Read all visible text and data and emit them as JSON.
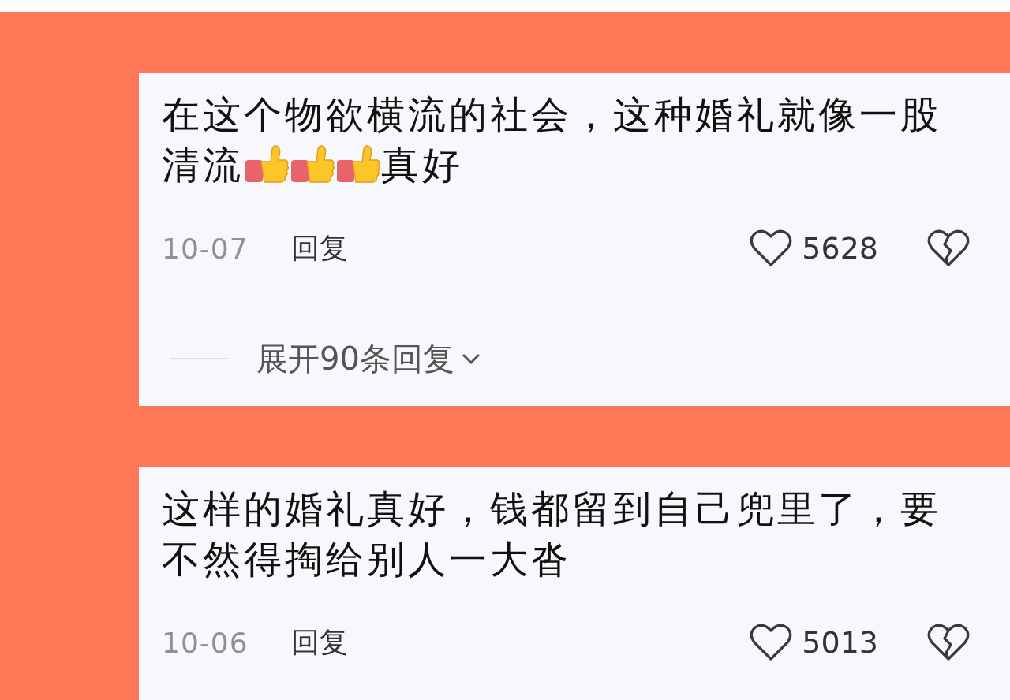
{
  "comments": [
    {
      "lines": [
        [
          {
            "kind": "text",
            "text": "在这个物欲横流的社会，这种婚礼就像一股"
          }
        ],
        [
          {
            "kind": "text",
            "text": "清流"
          },
          {
            "kind": "thumbs-up"
          },
          {
            "kind": "thumbs-up"
          },
          {
            "kind": "thumbs-up"
          },
          {
            "kind": "text",
            "text": "真好"
          }
        ]
      ],
      "date": "10-07",
      "reply": "回复",
      "likes": "5628",
      "expand": "展开90条回复"
    },
    {
      "lines": [
        [
          {
            "kind": "text",
            "text": "这样的婚礼真好，钱都留到自己兜里了，要"
          }
        ],
        [
          {
            "kind": "text",
            "text": "不然得掏给别人一大沓"
          }
        ]
      ],
      "date": "10-06",
      "reply": "回复",
      "likes": "5013"
    }
  ]
}
